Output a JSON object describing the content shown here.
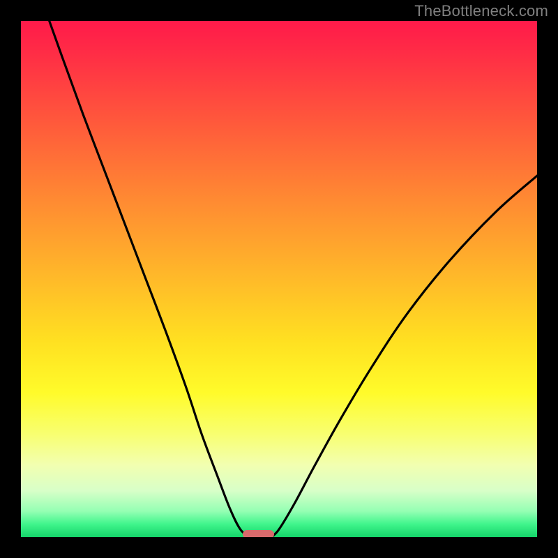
{
  "watermark": "TheBottleneck.com",
  "chart_data": {
    "type": "line",
    "title": "",
    "xlabel": "",
    "ylabel": "",
    "xlim": [
      0,
      100
    ],
    "ylim": [
      0,
      100
    ],
    "gradient_stops": [
      {
        "offset": 0.0,
        "color": "#ff1a4a"
      },
      {
        "offset": 0.07,
        "color": "#ff2f45"
      },
      {
        "offset": 0.2,
        "color": "#ff5a3b"
      },
      {
        "offset": 0.35,
        "color": "#ff8b32"
      },
      {
        "offset": 0.5,
        "color": "#ffba29"
      },
      {
        "offset": 0.62,
        "color": "#ffe021"
      },
      {
        "offset": 0.72,
        "color": "#fffb2a"
      },
      {
        "offset": 0.8,
        "color": "#f8ff70"
      },
      {
        "offset": 0.86,
        "color": "#f2ffb0"
      },
      {
        "offset": 0.91,
        "color": "#d8ffc8"
      },
      {
        "offset": 0.95,
        "color": "#94ffb3"
      },
      {
        "offset": 0.975,
        "color": "#40f58c"
      },
      {
        "offset": 1.0,
        "color": "#14d469"
      }
    ],
    "series": [
      {
        "name": "left-curve",
        "x": [
          5.5,
          8,
          12,
          16,
          20,
          24,
          28,
          32,
          35,
          38,
          40.5,
          42.5,
          44.3
        ],
        "values": [
          100,
          93,
          82,
          71.5,
          61,
          50.5,
          40,
          29,
          20,
          12,
          5.5,
          1.5,
          0
        ]
      },
      {
        "name": "right-curve",
        "x": [
          48.5,
          50,
          53,
          57,
          62,
          68,
          75,
          83,
          92,
          100
        ],
        "values": [
          0,
          1.5,
          6.5,
          14,
          23,
          33,
          43.5,
          53.5,
          63,
          70
        ]
      }
    ],
    "marker": {
      "x_center": 46.0,
      "y": 0.5,
      "width": 6.0,
      "height": 1.6,
      "color": "#d86a6c"
    },
    "frame_color": "#000000",
    "frame_thickness_px": 30
  }
}
